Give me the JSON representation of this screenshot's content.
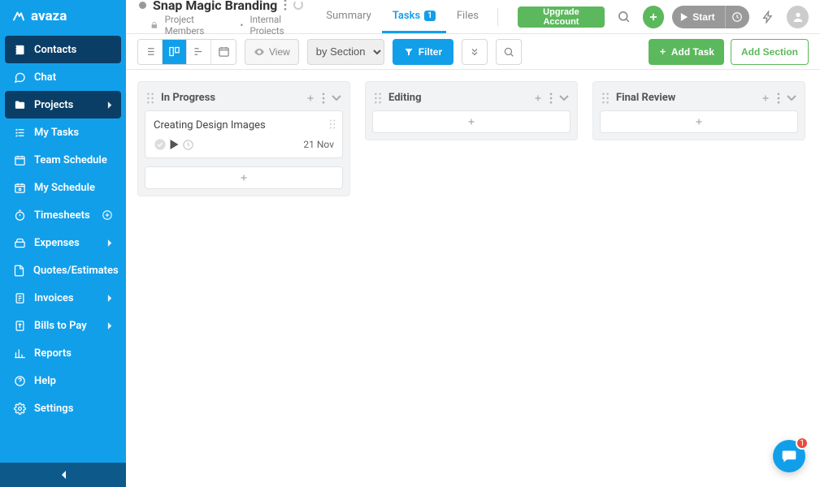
{
  "brand": "avaza",
  "project": {
    "title": "Snap Magic Branding",
    "members_label": "Project Members",
    "category": "Internal Projects"
  },
  "tabs": {
    "summary": "Summary",
    "tasks": "Tasks",
    "tasks_count": "1",
    "files": "Files"
  },
  "top": {
    "upgrade": "Upgrade Account",
    "start": "Start"
  },
  "toolbar": {
    "view": "View",
    "section_select": "by Section",
    "filter": "Filter",
    "add_task": "Add Task",
    "add_section": "Add Section"
  },
  "sidebar": {
    "items": [
      {
        "label": "Contacts"
      },
      {
        "label": "Chat"
      },
      {
        "label": "Projects"
      },
      {
        "label": "My Tasks"
      },
      {
        "label": "Team Schedule"
      },
      {
        "label": "My Schedule"
      },
      {
        "label": "Timesheets"
      },
      {
        "label": "Expenses"
      },
      {
        "label": "Quotes/Estimates"
      },
      {
        "label": "Invoices"
      },
      {
        "label": "Bills to Pay"
      },
      {
        "label": "Reports"
      },
      {
        "label": "Help"
      },
      {
        "label": "Settings"
      }
    ]
  },
  "board": {
    "columns": [
      {
        "title": "In Progress"
      },
      {
        "title": "Editing"
      },
      {
        "title": "Final Review"
      }
    ],
    "tasks": [
      {
        "title": "Creating Design Images",
        "date": "21 Nov"
      }
    ]
  },
  "chat_badge": "1"
}
